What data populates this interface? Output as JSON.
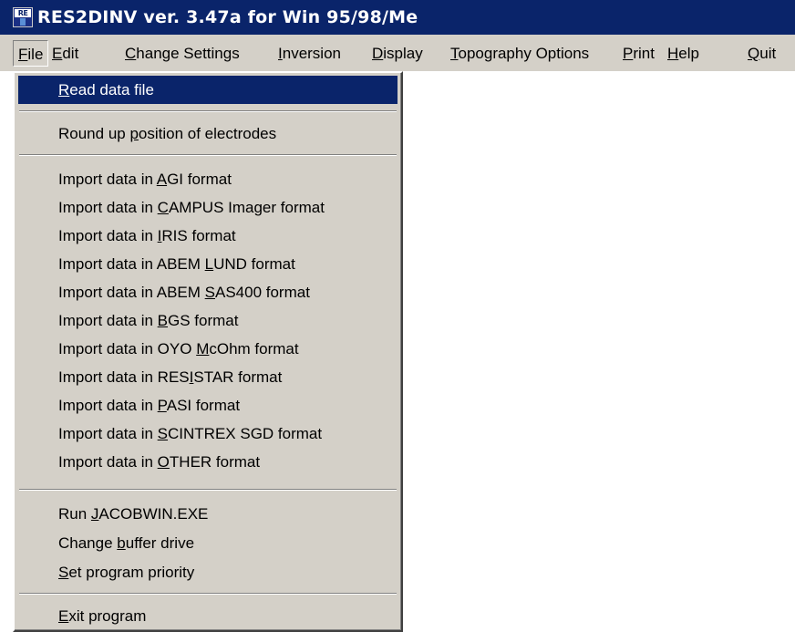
{
  "window": {
    "title": "RES2DINV ver. 3.47a for Win 95/98/Me",
    "icon": "app-logo-icon",
    "icon_text": "RE"
  },
  "menubar": {
    "items": [
      {
        "pre": "",
        "key": "F",
        "post": "ile"
      },
      {
        "pre": "",
        "key": "E",
        "post": "dit"
      },
      {
        "pre": "",
        "key": "C",
        "post": "hange Settings"
      },
      {
        "pre": "",
        "key": "I",
        "post": "nversion"
      },
      {
        "pre": "",
        "key": "D",
        "post": "isplay"
      },
      {
        "pre": "",
        "key": "T",
        "post": "opography Options"
      },
      {
        "pre": "",
        "key": "P",
        "post": "rint"
      },
      {
        "pre": "",
        "key": "H",
        "post": "elp"
      },
      {
        "pre": "",
        "key": "Q",
        "post": "uit"
      }
    ]
  },
  "file_menu": {
    "items": [
      {
        "pre": "",
        "key": "R",
        "post": "ead data file"
      },
      {
        "pre": "Round up ",
        "key": "p",
        "post": "osition of electrodes"
      },
      {
        "pre": "Import  data in ",
        "key": "A",
        "post": "GI format"
      },
      {
        "pre": "Import data in ",
        "key": "C",
        "post": "AMPUS Imager format"
      },
      {
        "pre": "Import data in ",
        "key": "I",
        "post": "RIS format"
      },
      {
        "pre": "Import data in ABEM ",
        "key": "L",
        "post": "UND format"
      },
      {
        "pre": "Import data in ABEM ",
        "key": "S",
        "post": "AS400 format"
      },
      {
        "pre": "Import data in ",
        "key": "B",
        "post": "GS format"
      },
      {
        "pre": "Import data in OYO ",
        "key": "M",
        "post": "cOhm format"
      },
      {
        "pre": "Import data in RES",
        "key": "I",
        "post": "STAR format"
      },
      {
        "pre": "Import data in ",
        "key": "P",
        "post": "ASI format"
      },
      {
        "pre": "Import data in ",
        "key": "S",
        "post": "CINTREX SGD format"
      },
      {
        "pre": "Import data in ",
        "key": "O",
        "post": "THER format"
      },
      {
        "pre": "Run ",
        "key": "J",
        "post": "ACOBWIN.EXE"
      },
      {
        "pre": "Change ",
        "key": "b",
        "post": "uffer drive"
      },
      {
        "pre": "",
        "key": "S",
        "post": "et program priority"
      },
      {
        "pre": "",
        "key": "E",
        "post": "xit program"
      }
    ]
  }
}
